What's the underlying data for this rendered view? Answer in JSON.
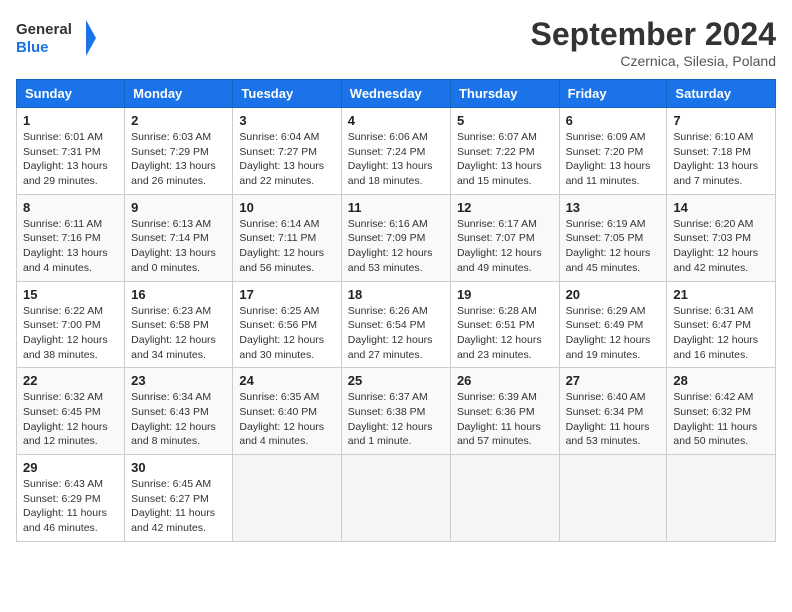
{
  "header": {
    "logo_line1": "General",
    "logo_line2": "Blue",
    "month": "September 2024",
    "location": "Czernica, Silesia, Poland"
  },
  "columns": [
    "Sunday",
    "Monday",
    "Tuesday",
    "Wednesday",
    "Thursday",
    "Friday",
    "Saturday"
  ],
  "weeks": [
    [
      {
        "day": "1",
        "sunrise": "6:01 AM",
        "sunset": "7:31 PM",
        "daylight": "13 hours and 29 minutes."
      },
      {
        "day": "2",
        "sunrise": "6:03 AM",
        "sunset": "7:29 PM",
        "daylight": "13 hours and 26 minutes."
      },
      {
        "day": "3",
        "sunrise": "6:04 AM",
        "sunset": "7:27 PM",
        "daylight": "13 hours and 22 minutes."
      },
      {
        "day": "4",
        "sunrise": "6:06 AM",
        "sunset": "7:24 PM",
        "daylight": "13 hours and 18 minutes."
      },
      {
        "day": "5",
        "sunrise": "6:07 AM",
        "sunset": "7:22 PM",
        "daylight": "13 hours and 15 minutes."
      },
      {
        "day": "6",
        "sunrise": "6:09 AM",
        "sunset": "7:20 PM",
        "daylight": "13 hours and 11 minutes."
      },
      {
        "day": "7",
        "sunrise": "6:10 AM",
        "sunset": "7:18 PM",
        "daylight": "13 hours and 7 minutes."
      }
    ],
    [
      {
        "day": "8",
        "sunrise": "6:11 AM",
        "sunset": "7:16 PM",
        "daylight": "13 hours and 4 minutes."
      },
      {
        "day": "9",
        "sunrise": "6:13 AM",
        "sunset": "7:14 PM",
        "daylight": "13 hours and 0 minutes."
      },
      {
        "day": "10",
        "sunrise": "6:14 AM",
        "sunset": "7:11 PM",
        "daylight": "12 hours and 56 minutes."
      },
      {
        "day": "11",
        "sunrise": "6:16 AM",
        "sunset": "7:09 PM",
        "daylight": "12 hours and 53 minutes."
      },
      {
        "day": "12",
        "sunrise": "6:17 AM",
        "sunset": "7:07 PM",
        "daylight": "12 hours and 49 minutes."
      },
      {
        "day": "13",
        "sunrise": "6:19 AM",
        "sunset": "7:05 PM",
        "daylight": "12 hours and 45 minutes."
      },
      {
        "day": "14",
        "sunrise": "6:20 AM",
        "sunset": "7:03 PM",
        "daylight": "12 hours and 42 minutes."
      }
    ],
    [
      {
        "day": "15",
        "sunrise": "6:22 AM",
        "sunset": "7:00 PM",
        "daylight": "12 hours and 38 minutes."
      },
      {
        "day": "16",
        "sunrise": "6:23 AM",
        "sunset": "6:58 PM",
        "daylight": "12 hours and 34 minutes."
      },
      {
        "day": "17",
        "sunrise": "6:25 AM",
        "sunset": "6:56 PM",
        "daylight": "12 hours and 30 minutes."
      },
      {
        "day": "18",
        "sunrise": "6:26 AM",
        "sunset": "6:54 PM",
        "daylight": "12 hours and 27 minutes."
      },
      {
        "day": "19",
        "sunrise": "6:28 AM",
        "sunset": "6:51 PM",
        "daylight": "12 hours and 23 minutes."
      },
      {
        "day": "20",
        "sunrise": "6:29 AM",
        "sunset": "6:49 PM",
        "daylight": "12 hours and 19 minutes."
      },
      {
        "day": "21",
        "sunrise": "6:31 AM",
        "sunset": "6:47 PM",
        "daylight": "12 hours and 16 minutes."
      }
    ],
    [
      {
        "day": "22",
        "sunrise": "6:32 AM",
        "sunset": "6:45 PM",
        "daylight": "12 hours and 12 minutes."
      },
      {
        "day": "23",
        "sunrise": "6:34 AM",
        "sunset": "6:43 PM",
        "daylight": "12 hours and 8 minutes."
      },
      {
        "day": "24",
        "sunrise": "6:35 AM",
        "sunset": "6:40 PM",
        "daylight": "12 hours and 4 minutes."
      },
      {
        "day": "25",
        "sunrise": "6:37 AM",
        "sunset": "6:38 PM",
        "daylight": "12 hours and 1 minute."
      },
      {
        "day": "26",
        "sunrise": "6:39 AM",
        "sunset": "6:36 PM",
        "daylight": "11 hours and 57 minutes."
      },
      {
        "day": "27",
        "sunrise": "6:40 AM",
        "sunset": "6:34 PM",
        "daylight": "11 hours and 53 minutes."
      },
      {
        "day": "28",
        "sunrise": "6:42 AM",
        "sunset": "6:32 PM",
        "daylight": "11 hours and 50 minutes."
      }
    ],
    [
      {
        "day": "29",
        "sunrise": "6:43 AM",
        "sunset": "6:29 PM",
        "daylight": "11 hours and 46 minutes."
      },
      {
        "day": "30",
        "sunrise": "6:45 AM",
        "sunset": "6:27 PM",
        "daylight": "11 hours and 42 minutes."
      },
      null,
      null,
      null,
      null,
      null
    ]
  ]
}
